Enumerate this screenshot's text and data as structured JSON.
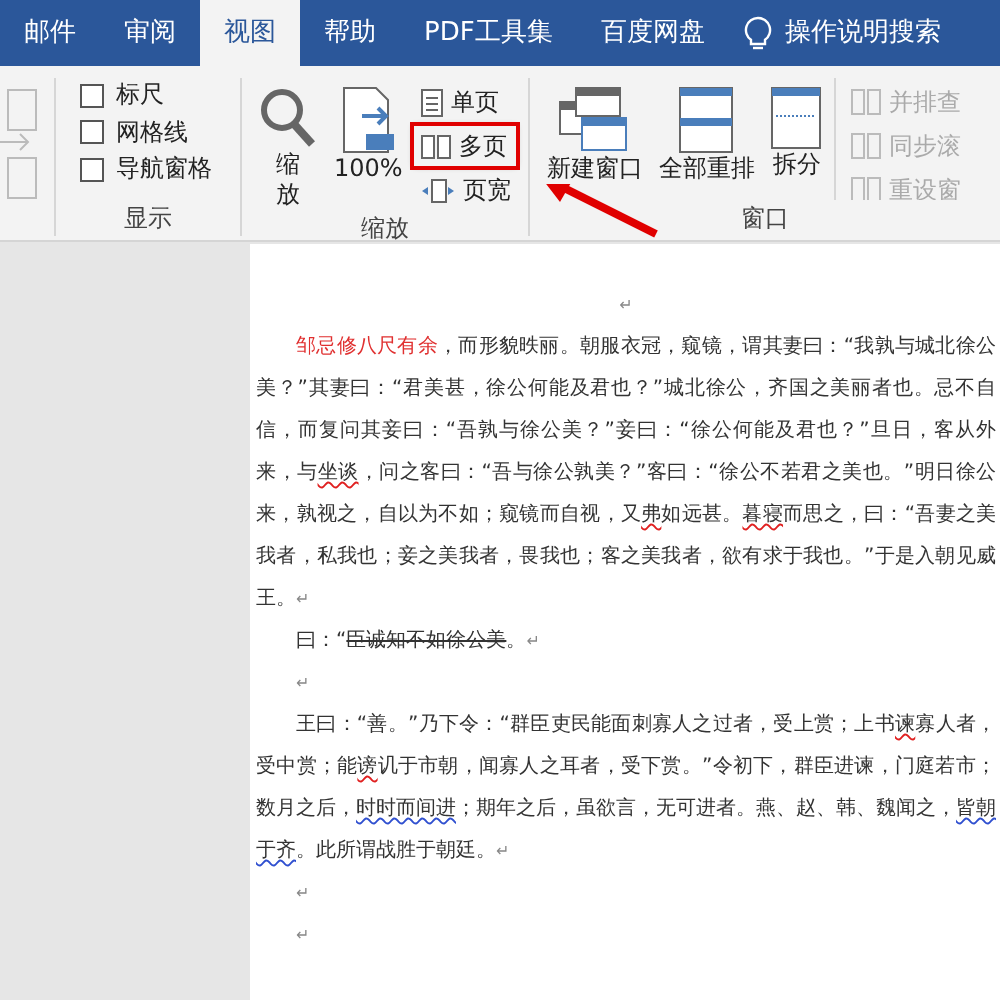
{
  "tabs": [
    {
      "label": "邮件",
      "selected": false
    },
    {
      "label": "审阅",
      "selected": false
    },
    {
      "label": "视图",
      "selected": true
    },
    {
      "label": "帮助",
      "selected": false
    },
    {
      "label": "PDF工具集",
      "selected": false
    },
    {
      "label": "百度网盘",
      "selected": false
    }
  ],
  "tell_me": {
    "label": "操作说明搜索"
  },
  "ribbon": {
    "groups": [
      {
        "label": "显示",
        "items": [
          {
            "kind": "checkbox",
            "label": "标尺",
            "checked": false
          },
          {
            "kind": "checkbox",
            "label": "网格线",
            "checked": false
          },
          {
            "kind": "checkbox",
            "label": "导航窗格",
            "checked": false
          }
        ]
      },
      {
        "label": "缩放",
        "items": [
          {
            "kind": "zoom",
            "label": "缩放",
            "disabled": false,
            "highlighted": false
          },
          {
            "kind": "zoom100",
            "label": "100%",
            "disabled": false,
            "highlighted": false
          },
          {
            "kind": "one-page",
            "label": "单页",
            "disabled": false,
            "highlighted": false
          },
          {
            "kind": "multi-page",
            "label": "多页",
            "disabled": false,
            "highlighted": true
          },
          {
            "kind": "page-width",
            "label": "页宽",
            "disabled": false,
            "highlighted": false
          }
        ]
      },
      {
        "label": "窗口",
        "items": [
          {
            "kind": "new-window",
            "label": "新建窗口",
            "disabled": false,
            "highlighted": false
          },
          {
            "kind": "arrange-all",
            "label": "全部重排",
            "disabled": false,
            "highlighted": false
          },
          {
            "kind": "split",
            "label": "拆分",
            "disabled": false,
            "highlighted": false
          },
          {
            "kind": "side-by-side",
            "label": "并排查",
            "disabled": true,
            "highlighted": false
          },
          {
            "kind": "sync-scroll",
            "label": "同步滚",
            "disabled": true,
            "highlighted": false
          },
          {
            "kind": "reset-window",
            "label": "重设窗",
            "disabled": true,
            "highlighted": false
          }
        ]
      }
    ]
  },
  "document": {
    "paragraphs": [
      {
        "kind": "centered",
        "segments": [
          {
            "kind": "mark",
            "text": "↵"
          }
        ]
      },
      {
        "kind": "body",
        "segments": [
          {
            "kind": "red",
            "text": "邹忌修八尺有余"
          },
          {
            "kind": "plain",
            "text": "，而形貌昳丽。朝服衣冠，窥镜，谓其妻曰：“我孰与城北徐公美？”其妻曰：“君美甚，徐公何能及君也？”城北徐公，齐国之美丽者也。忌不自信，而复问其妾曰：“吾孰与徐公美？”妾曰：“徐公何能及君也？”旦日，客从外来，与"
          },
          {
            "kind": "misspelled",
            "text": "坐谈"
          },
          {
            "kind": "plain",
            "text": "，问之客曰：“吾与徐公孰美？”客曰：“徐公不若君之美也。”明日徐公来，孰视之，自以为不如；窥镜而自视，又"
          },
          {
            "kind": "misspelled",
            "text": "弗"
          },
          {
            "kind": "plain",
            "text": "如远甚。"
          },
          {
            "kind": "misspelled",
            "text": "暮寝"
          },
          {
            "kind": "plain",
            "text": "而思之，曰：“吾妻之美我者，私我也；妾之美我者，畏我也；客之美我者，欲有求于我也。”于是入朝见威王。"
          },
          {
            "kind": "mark",
            "text": "↵"
          }
        ]
      },
      {
        "kind": "body",
        "segments": [
          {
            "kind": "plain",
            "text": "曰：“"
          },
          {
            "kind": "struck",
            "text": "臣诚知不如徐公美"
          },
          {
            "kind": "plain",
            "text": "。"
          },
          {
            "kind": "mark",
            "text": "↵"
          }
        ]
      },
      {
        "kind": "body",
        "segments": [
          {
            "kind": "mark",
            "text": "↵"
          }
        ]
      },
      {
        "kind": "body",
        "segments": [
          {
            "kind": "plain",
            "text": "王曰：“善。”乃下令：“群臣吏民能面刺寡人之过者，受上赏；上书"
          },
          {
            "kind": "misspelled",
            "text": "谏"
          },
          {
            "kind": "plain",
            "text": "寡人者，受中赏；能"
          },
          {
            "kind": "misspelled",
            "text": "谤"
          },
          {
            "kind": "plain",
            "text": "讥于市朝，闻寡人之耳者，受下赏。”令初下，群臣进谏，门庭若市；数月之后，"
          },
          {
            "kind": "grammar",
            "text": "时时而间进"
          },
          {
            "kind": "plain",
            "text": "；期年之后，虽欲言，无可进者。燕、赵、韩、魏闻之，"
          },
          {
            "kind": "grammar",
            "text": "皆朝于齐"
          },
          {
            "kind": "plain",
            "text": "。此所谓战胜于朝廷。"
          },
          {
            "kind": "mark",
            "text": "↵"
          }
        ]
      },
      {
        "kind": "body",
        "segments": [
          {
            "kind": "mark",
            "text": "↵"
          }
        ]
      },
      {
        "kind": "body",
        "segments": [
          {
            "kind": "mark",
            "text": "↵"
          }
        ]
      }
    ]
  }
}
